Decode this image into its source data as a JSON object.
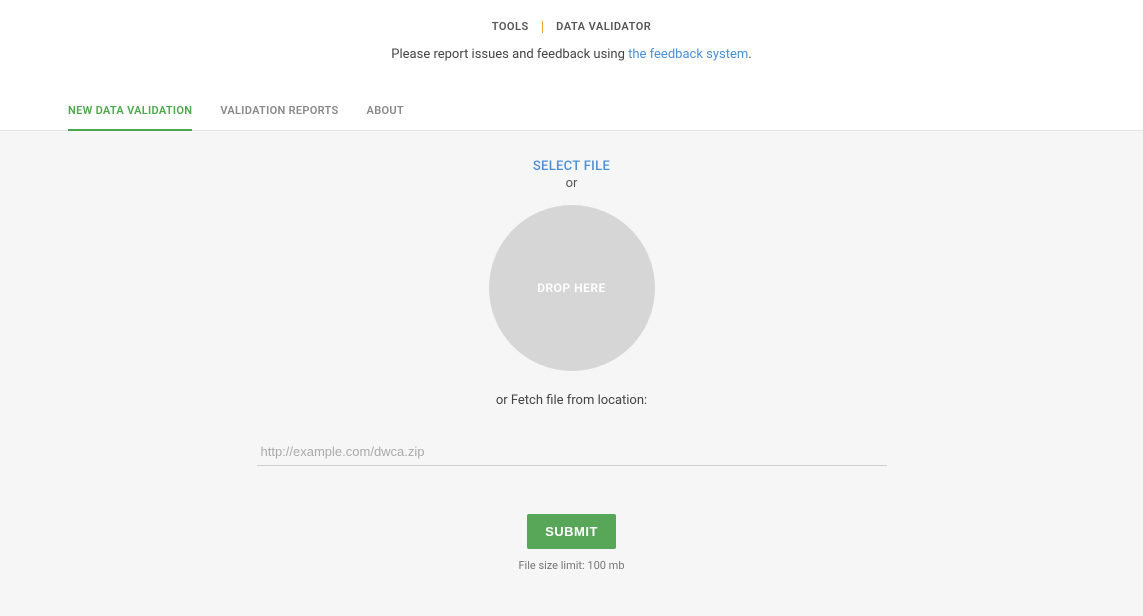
{
  "breadcrumb": {
    "parent": "TOOLS",
    "current": "DATA VALIDATOR"
  },
  "feedback": {
    "prefix": "Please report issues and feedback using ",
    "link_text": "the feedback system",
    "suffix": "."
  },
  "tabs": {
    "new_validation": "NEW DATA VALIDATION",
    "reports": "VALIDATION REPORTS",
    "about": "ABOUT"
  },
  "upload": {
    "select_file": "SELECT FILE",
    "or": "or",
    "drop_here": "DROP HERE",
    "fetch_label": "or Fetch file from location:",
    "url_placeholder": "http://example.com/dwca.zip",
    "submit": "SUBMIT",
    "size_limit": "File size limit: 100 mb"
  }
}
